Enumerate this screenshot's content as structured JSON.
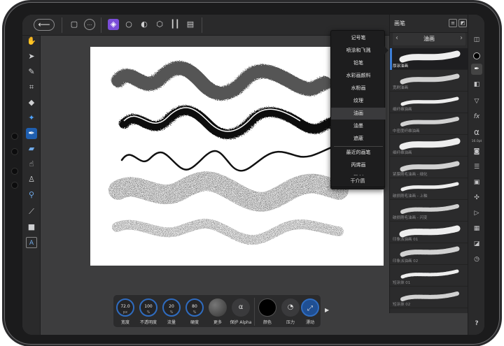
{
  "toolbar": {
    "back_glyph": "⟵",
    "more_glyph": "···"
  },
  "tools": [
    "move",
    "select",
    "color-picker",
    "crop",
    "fill",
    "brush-select",
    "paint-brush",
    "eraser",
    "smudge",
    "dodge",
    "clone",
    "dropper",
    "shape",
    "text"
  ],
  "dropdown": {
    "items": [
      "记号笔",
      "喷涂和飞溅",
      "铅笔",
      "水彩画颜料",
      "水粉画",
      "纹理",
      "油画",
      "油墨",
      "遮蔽",
      "最近的画笔",
      "丙烯画",
      "雕刻",
      "干介质"
    ],
    "selected_index": 6
  },
  "panel": {
    "title": "画笔",
    "category": "油画",
    "prev": "‹",
    "next": "›",
    "brushes": [
      {
        "name": "厚涂油画",
        "selected": true
      },
      {
        "name": "宽刷油画"
      },
      {
        "name": "细纤维油画"
      },
      {
        "name": "中密度纤维油画"
      },
      {
        "name": "细纤维油画"
      },
      {
        "name": "紧膜刚毛油画 - 细化"
      },
      {
        "name": "破损刚毛油画 - 上釉"
      },
      {
        "name": "破损刚毛油画 - 闪变"
      },
      {
        "name": "印象派油画 01"
      },
      {
        "name": "印象派油画 02"
      },
      {
        "name": "短涂抹 01"
      },
      {
        "name": "短涂抹 02"
      }
    ]
  },
  "studio": {
    "alpha_label": "α",
    "size_label": "16.0pt",
    "fx_label": "fx",
    "help_label": "?"
  },
  "context": {
    "width": {
      "value": "72.0",
      "unit": "px",
      "label": "宽度"
    },
    "opacity": {
      "value": "100",
      "unit": "%",
      "label": "不透明度"
    },
    "flow": {
      "value": "20",
      "unit": "%",
      "label": "流量"
    },
    "hardness": {
      "value": "80",
      "unit": "%",
      "label": "硬度"
    },
    "more_label": "更多",
    "protect_alpha_label": "保护 Alpha",
    "alpha_glyph": "α",
    "color_label": "颜色",
    "pressure_label": "压力",
    "stabilizer_label": "漂动",
    "color": "#000000"
  },
  "colors": {
    "accent": "#2f6cc0",
    "persona": "#7a4dd8",
    "bg": "#3d3d3e"
  }
}
